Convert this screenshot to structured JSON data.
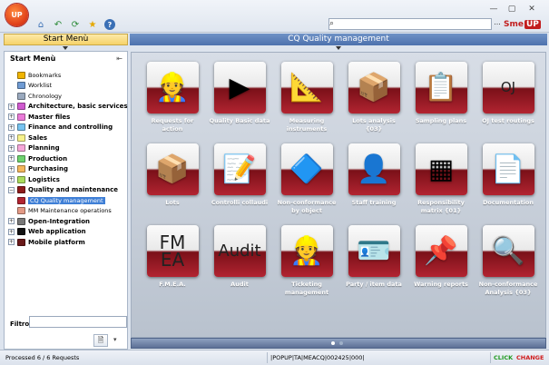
{
  "app": {
    "logo": "UP",
    "brand_a": "Sme",
    "brand_b": "UP"
  },
  "toolbar": {
    "icons": [
      "home-icon",
      "back-arrow-icon",
      "refresh-icon",
      "star-icon",
      "help-icon"
    ],
    "window": [
      "minimize-icon",
      "maximize-icon",
      "close-icon"
    ],
    "search_value": "",
    "more_label": "..."
  },
  "left_header": "Start Menù",
  "right_header": "CQ Quality management",
  "left_panel": {
    "title": "Start Menù",
    "filter_label": "Filtro:",
    "filter_value": ""
  },
  "tree": [
    {
      "label": "Bookmarks",
      "type": "sub",
      "icon_color": "#f0b400",
      "level": 1
    },
    {
      "label": "Worklist",
      "type": "sub",
      "icon_color": "#6f9bd3",
      "level": 1
    },
    {
      "label": "Chronology",
      "type": "sub",
      "icon_color": "#9aa9be",
      "level": 1
    },
    {
      "label": "Architecture, basic services",
      "type": "cat",
      "icon_color": "#d05ad0",
      "level": 0
    },
    {
      "label": "Master files",
      "type": "cat",
      "icon_color": "#ea7ad8",
      "level": 0
    },
    {
      "label": "Finance and controlling",
      "type": "cat",
      "icon_color": "#76c3f0",
      "level": 0
    },
    {
      "label": "Sales",
      "type": "cat",
      "icon_color": "#f7f28a",
      "level": 0
    },
    {
      "label": "Planning",
      "type": "cat",
      "icon_color": "#f6a6d9",
      "level": 0
    },
    {
      "label": "Production",
      "type": "cat",
      "icon_color": "#6ed36e",
      "level": 0
    },
    {
      "label": "Purchasing",
      "type": "cat",
      "icon_color": "#f4b75c",
      "level": 0
    },
    {
      "label": "Logistics",
      "type": "cat",
      "icon_color": "#aadb5c",
      "level": 0
    },
    {
      "label": "Quality and maintenance",
      "type": "cat",
      "icon_color": "#8e1b1b",
      "level": 0,
      "expanded": true
    },
    {
      "label": "CQ Quality management",
      "type": "sub",
      "icon_color": "#b22431",
      "level": 1,
      "selected": true
    },
    {
      "label": "MM Maintenance operations",
      "type": "sub",
      "icon_color": "#e39a86",
      "level": 1
    },
    {
      "label": "Open-Integration",
      "type": "cat",
      "icon_color": "#777777",
      "level": 0
    },
    {
      "label": "Web application",
      "type": "cat",
      "icon_color": "#111111",
      "level": 0
    },
    {
      "label": "Mobile platform",
      "type": "cat",
      "icon_color": "#6a1a1a",
      "level": 0
    }
  ],
  "tiles": [
    {
      "label": "Requests for action",
      "icon": "person-red-cap-icon",
      "glyph": "👷"
    },
    {
      "label": "Quality Basic data",
      "icon": "video-play-icon",
      "glyph": "▶"
    },
    {
      "label": "Measuring instruments",
      "icon": "ruler-triangle-icon",
      "glyph": "📐"
    },
    {
      "label": "Lots analysis {03}",
      "icon": "boxes-search-icon",
      "glyph": "📦"
    },
    {
      "label": "Sampling plans",
      "icon": "clipboard-check-icon",
      "glyph": "📋"
    },
    {
      "label": "OJ test routings",
      "icon": "oj-check-icon",
      "text": "OJ"
    },
    {
      "label": "Lots",
      "icon": "boxes-gear-icon",
      "glyph": "📦"
    },
    {
      "label": "Controlli collaudi",
      "icon": "checklist-gear-icon",
      "glyph": "📝"
    },
    {
      "label": "Non-conformance by object",
      "icon": "shapes-reject-icon",
      "glyph": "🔷"
    },
    {
      "label": "Staff training",
      "icon": "person-board-icon",
      "glyph": "👤"
    },
    {
      "label": "Responsibility matrix {01}",
      "icon": "matrix-grid-icon",
      "glyph": "▦"
    },
    {
      "label": "Documentation",
      "icon": "document-gear-icon",
      "glyph": "📄"
    },
    {
      "label": "F.M.E.A.",
      "icon": "fmea-text-icon",
      "text": "FM EA"
    },
    {
      "label": "Audit",
      "icon": "audit-text-icon",
      "text": "Audit"
    },
    {
      "label": "Ticketing management",
      "icon": "person-cap-icon",
      "glyph": "👷"
    },
    {
      "label": "Party / item data",
      "icon": "id-card-check-icon",
      "glyph": "🪪"
    },
    {
      "label": "Warning reports",
      "icon": "note-pin-icon",
      "glyph": "📌"
    },
    {
      "label": "Non-conformance Analysis {03}",
      "icon": "magnifier-reject-icon",
      "glyph": "🔍"
    }
  ],
  "status": {
    "processed": "Processed 6 / 6 Requests",
    "code": "|POPUP|TA|MEACQ|002425|000|",
    "click": "CLICK",
    "change": "CHANGE"
  },
  "colors": {
    "accent": "#b22431",
    "header_blue": "#4c71ad",
    "start_menu_yellow": "#f6d36a",
    "click_green": "#1f9a1f",
    "change_red": "#d01c1c"
  }
}
